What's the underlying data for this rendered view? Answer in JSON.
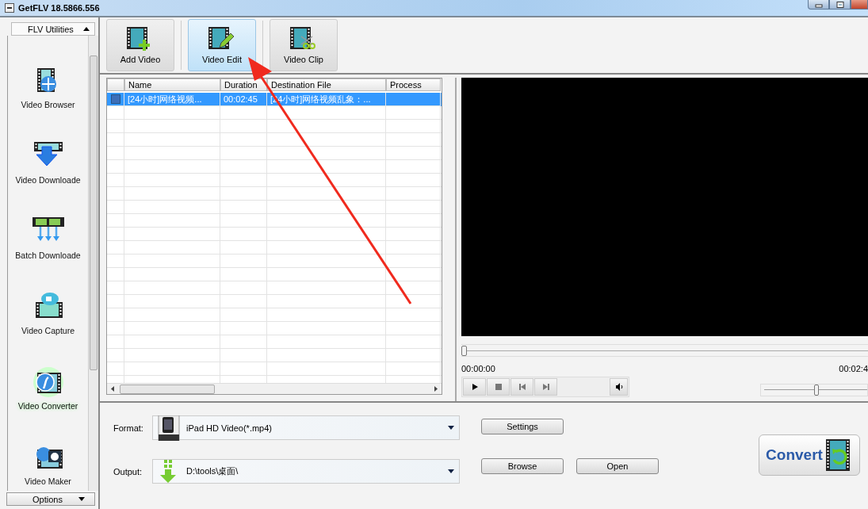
{
  "window": {
    "title": "GetFLV 18.5866.556"
  },
  "sidebar": {
    "header": "FLV Utilities",
    "items": [
      {
        "label": "Video Browser",
        "selected": false
      },
      {
        "label": "Video Downloade",
        "selected": false
      },
      {
        "label": "Batch Downloade",
        "selected": false
      },
      {
        "label": "Video Capture",
        "selected": false
      },
      {
        "label": "Video Converter",
        "selected": true
      },
      {
        "label": "Video Maker",
        "selected": false
      }
    ],
    "footer": "Options"
  },
  "toolbar": [
    {
      "label": "Add Video",
      "selected": false
    },
    {
      "label": "Video Edit",
      "selected": true
    },
    {
      "label": "Video Clip",
      "selected": false
    }
  ],
  "table": {
    "columns": [
      "Name",
      "Duration",
      "Destination File",
      "Process"
    ],
    "rows": [
      {
        "cells": [
          "[24小时]网络视频...",
          "00:02:45",
          "[24小时]网络视频乱象：...",
          ""
        ],
        "selected": true
      }
    ]
  },
  "player": {
    "seek": {
      "level": 0
    },
    "time_start": "00:00:00",
    "time_end": "00:02:4",
    "volume": {
      "level": 0.5
    }
  },
  "format": {
    "label": "Format:",
    "value": "iPad HD Video(*.mp4)"
  },
  "output": {
    "label": "Output:",
    "value": "D:\\tools\\桌面\\"
  },
  "buttons": {
    "settings": "Settings",
    "browse": "Browse",
    "open": "Open",
    "convert": "Convert"
  }
}
